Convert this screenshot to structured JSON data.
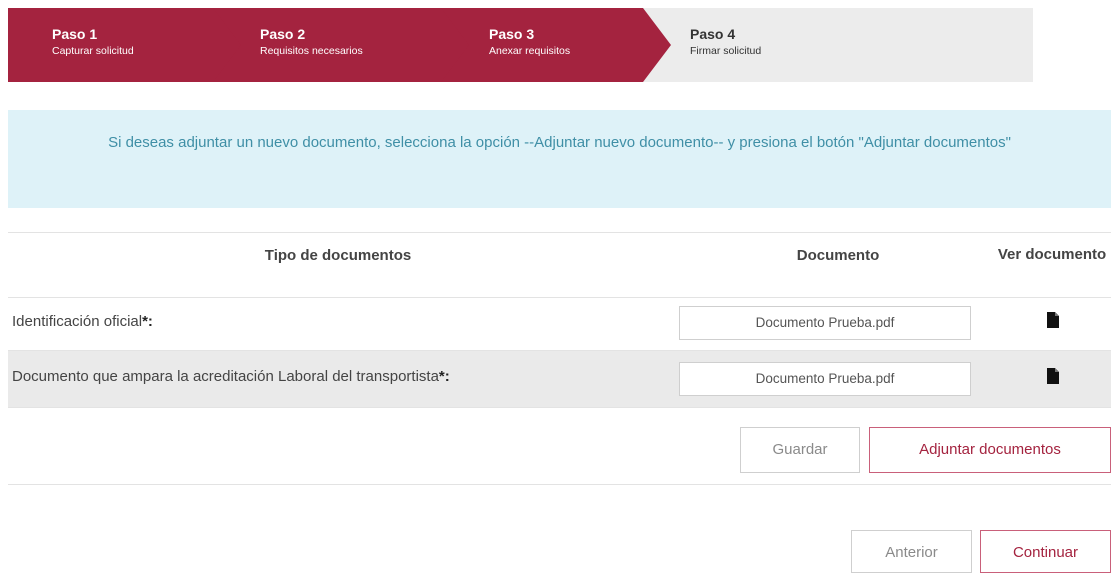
{
  "steps": [
    {
      "title": "Paso 1",
      "subtitle": "Capturar solicitud",
      "state": "active"
    },
    {
      "title": "Paso 2",
      "subtitle": "Requisitos necesarios",
      "state": "active"
    },
    {
      "title": "Paso 3",
      "subtitle": "Anexar requisitos",
      "state": "active"
    },
    {
      "title": "Paso 4",
      "subtitle": "Firmar solicitud",
      "state": "current"
    }
  ],
  "info": {
    "message": "Si deseas adjuntar un nuevo documento, selecciona la opción --Adjuntar nuevo documento-- y presiona el botón \"Adjuntar documentos\""
  },
  "table": {
    "headers": {
      "type": "Tipo de documentos",
      "document": "Documento",
      "view": "Ver documento"
    },
    "rows": [
      {
        "label": "Identificación oficial",
        "required": "*:",
        "file": "Documento Prueba.pdf"
      },
      {
        "label": "Documento que ampara la acreditación Laboral del transportista",
        "required": "*:",
        "file": "Documento Prueba.pdf"
      }
    ],
    "buttons": {
      "save": "Guardar",
      "attach": "Adjuntar documentos"
    }
  },
  "nav": {
    "previous": "Anterior",
    "next": "Continuar"
  },
  "colors": {
    "accent": "#a4233f",
    "banner_bg": "#def2f8",
    "banner_text": "#3f8fa6"
  },
  "icons": {
    "view_document": "file-icon"
  }
}
